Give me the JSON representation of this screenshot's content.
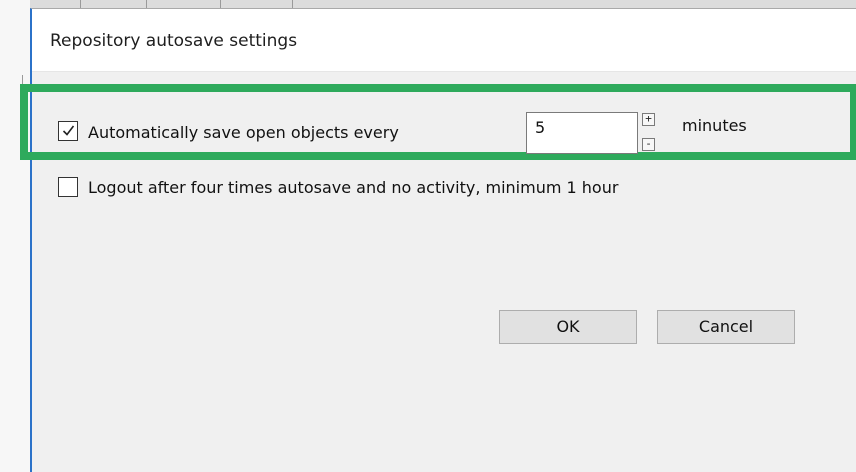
{
  "dialog": {
    "title": "Repository autosave settings"
  },
  "autosave": {
    "checked": true,
    "label": "Automatically save open objects every",
    "value": "5",
    "increment": "+",
    "decrement": "-",
    "unit": "minutes"
  },
  "logout": {
    "checked": false,
    "label": "Logout after four times autosave and no activity, minimum 1 hour"
  },
  "buttons": {
    "ok": "OK",
    "cancel": "Cancel"
  },
  "colors": {
    "highlight": "#2eaa5c",
    "window_border": "#2b72c9"
  }
}
